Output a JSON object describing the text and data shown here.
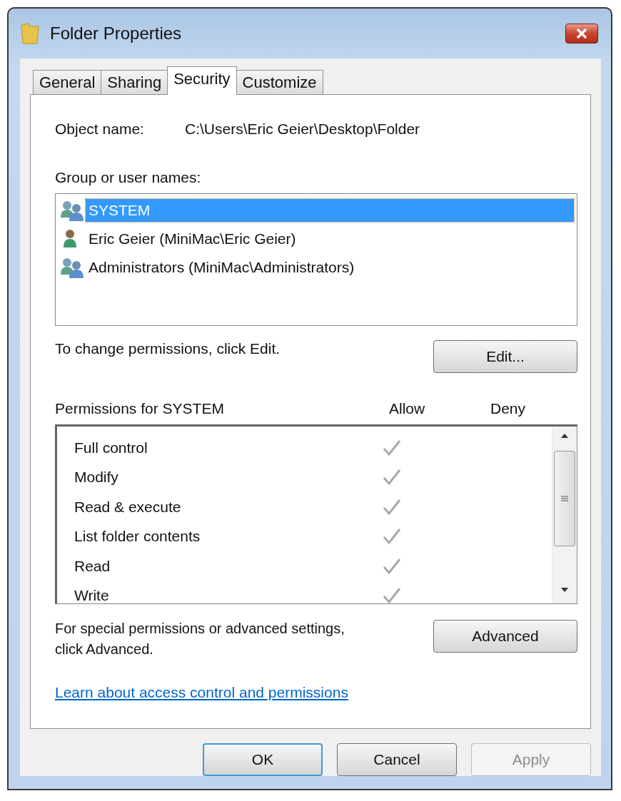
{
  "window": {
    "title": "Folder Properties"
  },
  "tabs": [
    {
      "label": "General",
      "selected": false
    },
    {
      "label": "Sharing",
      "selected": false
    },
    {
      "label": "Security",
      "selected": true
    },
    {
      "label": "Customize",
      "selected": false
    }
  ],
  "object_name": {
    "label": "Object name:",
    "value": "C:\\Users\\Eric Geier\\Desktop\\Folder"
  },
  "group_label": "Group or user names:",
  "users": [
    {
      "name": "SYSTEM",
      "kind": "group",
      "selected": true
    },
    {
      "name": "Eric Geier (MiniMac\\Eric Geier)",
      "kind": "user",
      "selected": false
    },
    {
      "name": "Administrators (MiniMac\\Administrators)",
      "kind": "group",
      "selected": false
    }
  ],
  "change_hint": "To change permissions, click Edit.",
  "edit_button": "Edit...",
  "permissions": {
    "title": "Permissions for SYSTEM",
    "allow_label": "Allow",
    "deny_label": "Deny",
    "rows": [
      {
        "name": "Full control",
        "allow": true
      },
      {
        "name": "Modify",
        "allow": true
      },
      {
        "name": "Read & execute",
        "allow": true
      },
      {
        "name": "List folder contents",
        "allow": true
      },
      {
        "name": "Read",
        "allow": true
      },
      {
        "name": "Write",
        "allow": true
      }
    ]
  },
  "advanced_hint": "For special permissions or advanced settings, click Advanced.",
  "advanced_button": "Advanced",
  "link": "Learn about access control and permissions",
  "buttons": [
    {
      "label": "OK",
      "kind": "default",
      "disabled": false
    },
    {
      "label": "Cancel",
      "kind": "normal",
      "disabled": false
    },
    {
      "label": "Apply",
      "kind": "normal",
      "disabled": true
    }
  ]
}
